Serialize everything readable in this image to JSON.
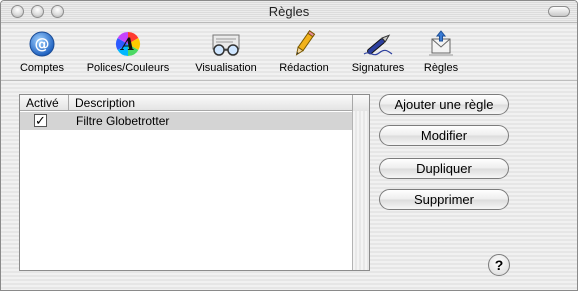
{
  "window": {
    "title": "Règles"
  },
  "toolbar": {
    "items": [
      {
        "label": "Comptes",
        "icon": "at-sign-icon"
      },
      {
        "label": "Polices/Couleurs",
        "icon": "color-font-icon"
      },
      {
        "label": "Visualisation",
        "icon": "glasses-icon"
      },
      {
        "label": "Rédaction",
        "icon": "pencil-icon"
      },
      {
        "label": "Signatures",
        "icon": "pen-icon"
      },
      {
        "label": "Règles",
        "icon": "rules-icon"
      }
    ]
  },
  "rules_table": {
    "columns": [
      "Activé",
      "Description"
    ],
    "rows": [
      {
        "enabled": "✓",
        "description": "Filtre Globetrotter"
      }
    ]
  },
  "actions": {
    "add": "Ajouter une règle",
    "edit": "Modifier",
    "duplicate": "Dupliquer",
    "delete": "Supprimer",
    "help": "?"
  }
}
